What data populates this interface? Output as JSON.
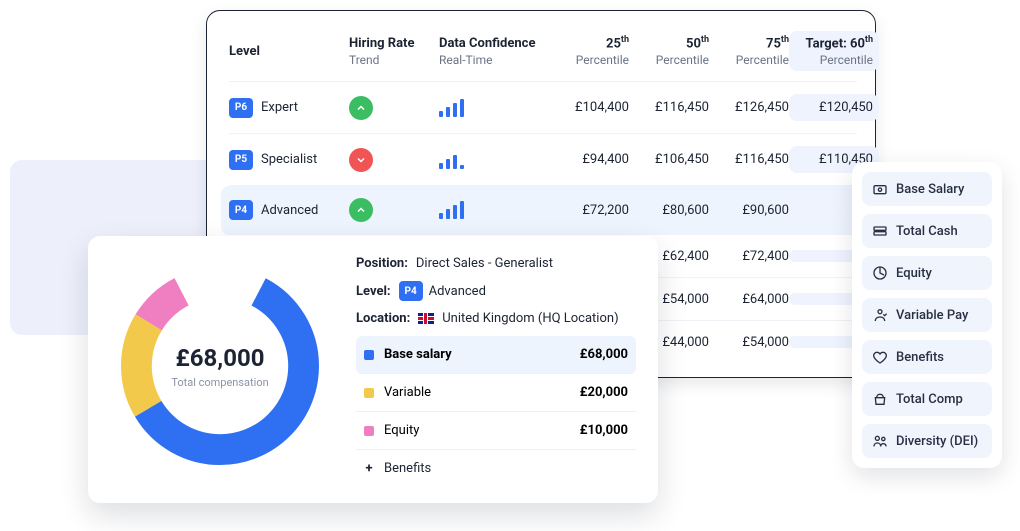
{
  "colors": {
    "blue": "#2f6ff1",
    "yellow": "#f3c94b",
    "pink": "#f07fc1",
    "green": "#3bbd62",
    "red": "#f15454"
  },
  "table": {
    "headers": {
      "level": "Level",
      "hiring": "Hiring Rate",
      "hiring_sub": "Trend",
      "conf": "Data Confidence",
      "conf_sub": "Real-Time",
      "p25": "25",
      "p50": "50",
      "p75": "75",
      "pct": "Percentile",
      "target": "Target: 60",
      "th": "th"
    },
    "rows": [
      {
        "badge": "P6",
        "name": "Expert",
        "trend": "up",
        "bars": [
          6,
          10,
          14,
          18
        ],
        "p25": "£104,400",
        "p50": "£116,450",
        "p75": "£126,450",
        "target": "£120,450"
      },
      {
        "badge": "P5",
        "name": "Specialist",
        "trend": "down",
        "bars": [
          6,
          10,
          14,
          4
        ],
        "p25": "£94,400",
        "p50": "£106,450",
        "p75": "£116,450",
        "target": "£110,450"
      },
      {
        "badge": "P4",
        "name": "Advanced",
        "trend": "up",
        "bars": [
          6,
          10,
          14,
          18
        ],
        "p25": "£72,200",
        "p50": "£80,600",
        "p75": "£90,600",
        "target": "",
        "highlight": true
      },
      {
        "badge": "",
        "name": "",
        "trend": "",
        "bars": [],
        "p25": "",
        "p50": "£62,400",
        "p75": "£72,400",
        "target": ""
      },
      {
        "badge": "",
        "name": "",
        "trend": "",
        "bars": [],
        "p25": "",
        "p50": "£54,000",
        "p75": "£64,000",
        "target": ""
      },
      {
        "badge": "",
        "name": "",
        "trend": "",
        "bars": [],
        "p25": "",
        "p50": "£44,000",
        "p75": "£54,000",
        "target": ""
      }
    ]
  },
  "menu": [
    {
      "icon": "base-salary",
      "label": "Base Salary"
    },
    {
      "icon": "total-cash",
      "label": "Total Cash"
    },
    {
      "icon": "equity",
      "label": "Equity"
    },
    {
      "icon": "variable",
      "label": "Variable Pay"
    },
    {
      "icon": "benefits",
      "label": "Benefits"
    },
    {
      "icon": "total-comp",
      "label": "Total Comp"
    },
    {
      "icon": "diversity",
      "label": "Diversity (DEI)"
    }
  ],
  "comp": {
    "total_value": "£68,000",
    "total_label": "Total compensation",
    "position_k": "Position:",
    "position_v": "Direct Sales - Generalist",
    "level_k": "Level:",
    "level_badge": "P4",
    "level_name": "Advanced",
    "location_k": "Location:",
    "location_v": "United Kingdom (HQ Location)",
    "rows": [
      {
        "color": "#2f6ff1",
        "label": "Base salary",
        "value": "£68,000",
        "selected": true,
        "bold": true
      },
      {
        "color": "#f3c94b",
        "label": "Variable",
        "value": "£20,000",
        "selected": false,
        "bold": false
      },
      {
        "color": "#f07fc1",
        "label": "Equity",
        "value": "£10,000",
        "selected": false,
        "bold": false
      }
    ],
    "benefits_label": "Benefits"
  },
  "chart_data": {
    "type": "pie",
    "title": "Total compensation",
    "series": [
      {
        "name": "Base salary",
        "value": 68000,
        "color": "#2f6ff1"
      },
      {
        "name": "Variable",
        "value": 20000,
        "color": "#f3c94b"
      },
      {
        "name": "Equity",
        "value": 10000,
        "color": "#f07fc1"
      }
    ],
    "total_display": "£68,000"
  }
}
